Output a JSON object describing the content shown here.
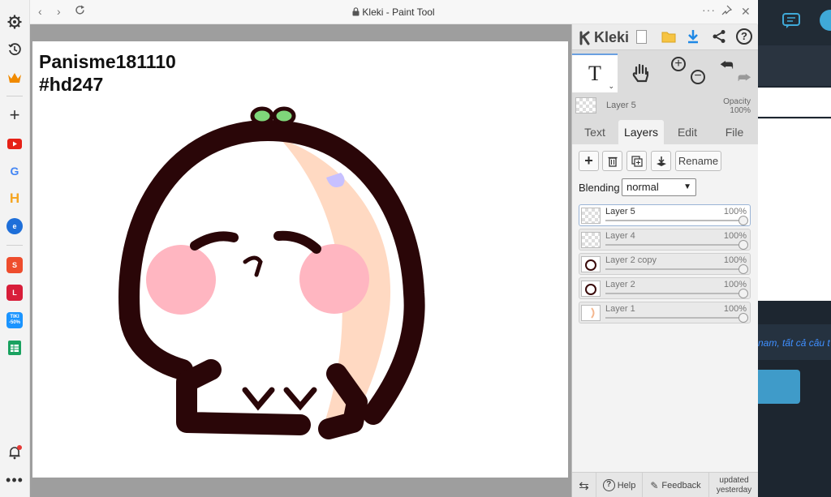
{
  "browser": {
    "title": "Kleki - Paint Tool",
    "sidebar_icons": [
      "gear-icon",
      "history-icon",
      "crown-icon",
      "plus-icon",
      "youtube-icon",
      "google-icon",
      "h-app-icon",
      "edge-app-icon",
      "shopee-icon",
      "lazada-icon",
      "tiki-icon",
      "sheets-icon",
      "bell-icon",
      "more-icon"
    ],
    "tiki_label": "TIKI",
    "tiki_discount": "-50%"
  },
  "canvas": {
    "line1": "Panisme181110",
    "line2": "#hd247"
  },
  "panel": {
    "logo": "Kleki",
    "active_layer": {
      "name": "Layer 5",
      "opacity_label": "Opacity",
      "opacity_value": "100%"
    },
    "tabs": [
      {
        "label": "Text"
      },
      {
        "label": "Layers"
      },
      {
        "label": "Edit"
      },
      {
        "label": "File"
      }
    ],
    "rename_label": "Rename",
    "blending_label": "Blending",
    "blending_value": "normal",
    "layers": [
      {
        "name": "Layer 5",
        "opacity": "100%"
      },
      {
        "name": "Layer 4",
        "opacity": "100%"
      },
      {
        "name": "Layer 2 copy",
        "opacity": "100%"
      },
      {
        "name": "Layer 2",
        "opacity": "100%"
      },
      {
        "name": "Layer 1",
        "opacity": "100%"
      }
    ],
    "footer": {
      "help": "Help",
      "feedback": "Feedback",
      "updated": "updated",
      "when": "yesterday"
    }
  },
  "background_page": {
    "snippet": "nam, tất cả câu t"
  },
  "colors": {
    "canvas_gray": "#9e9e9e",
    "panel_bg": "#dcdcdc",
    "accent_blue": "#1e88e5",
    "bg_dark": "#1d2630"
  }
}
